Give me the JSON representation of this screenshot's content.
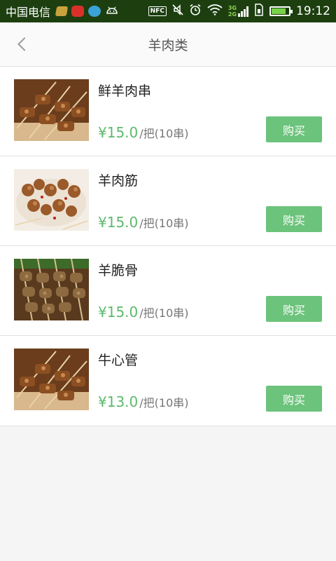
{
  "status_bar": {
    "carrier": "中国电信",
    "nfc_label": "NFC",
    "net_labels": [
      "3G",
      "2G"
    ],
    "battery_level": 0.75,
    "time": "19:12"
  },
  "header": {
    "title": "羊肉类",
    "back_icon": "chevron-left-icon"
  },
  "products": [
    {
      "name": "鲜羊肉串",
      "price": "¥15.0",
      "unit": "/把(10串)",
      "buy_label": "购买"
    },
    {
      "name": "羊肉筋",
      "price": "¥15.0",
      "unit": "/把(10串)",
      "buy_label": "购买"
    },
    {
      "name": "羊脆骨",
      "price": "¥15.0",
      "unit": "/把(10串)",
      "buy_label": "购买"
    },
    {
      "name": "牛心管",
      "price": "¥13.0",
      "unit": "/把(10串)",
      "buy_label": "购买"
    }
  ],
  "colors": {
    "status_bar": "#1d3f10",
    "price": "#5cba6b",
    "buy_button": "#6cc37b"
  }
}
